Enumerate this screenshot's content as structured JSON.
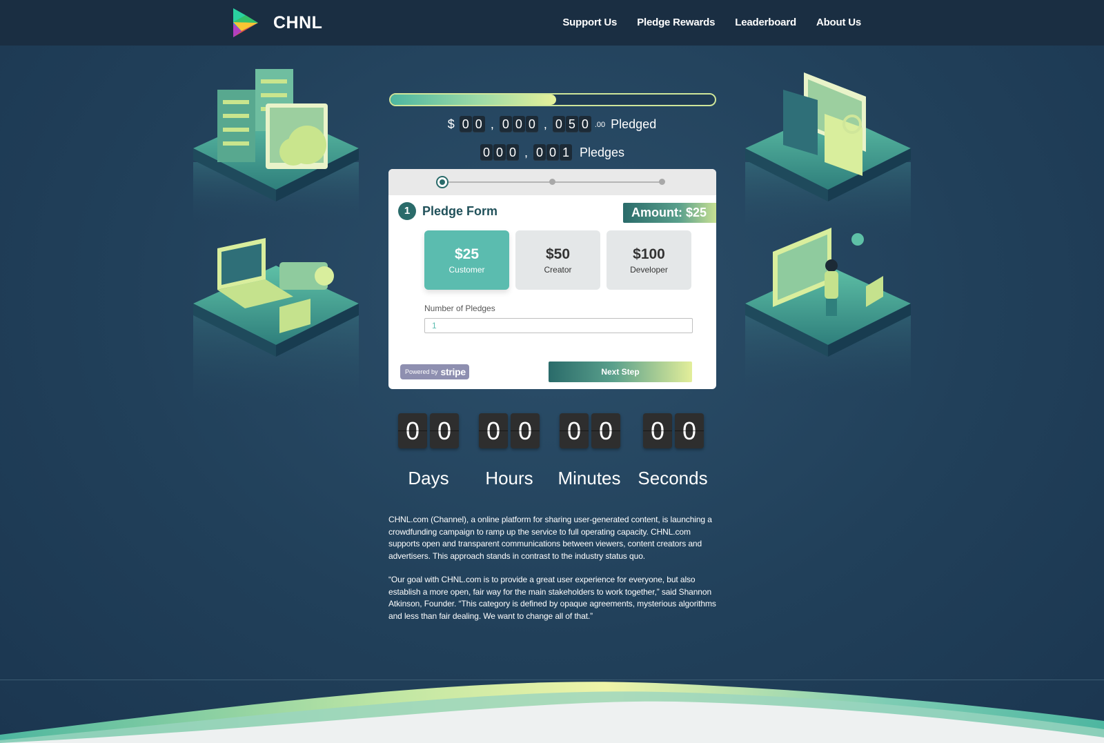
{
  "header": {
    "brand": "CHNL",
    "nav": [
      "Support Us",
      "Pledge Rewards",
      "Leaderboard",
      "About Us"
    ]
  },
  "campaign": {
    "progress_fraction": 0.51,
    "pledged": {
      "currency": "$",
      "groups": [
        "00",
        "000",
        "050"
      ],
      "cents": ".00",
      "label": "Pledged"
    },
    "pledges": {
      "groups": [
        "000",
        "001"
      ],
      "label": "Pledges"
    }
  },
  "form": {
    "step_number": "1",
    "title": "Pledge Form",
    "amount_badge": "Amount: $25",
    "tiers": [
      {
        "price": "$25",
        "role": "Customer",
        "selected": true
      },
      {
        "price": "$50",
        "role": "Creator",
        "selected": false
      },
      {
        "price": "$100",
        "role": "Developer",
        "selected": false
      }
    ],
    "pledges_label": "Number of Pledges",
    "pledges_value": "1",
    "stripe_powered": "Powered by",
    "stripe_word": "stripe",
    "next_button": "Next Step"
  },
  "countdown": {
    "days": [
      "0",
      "0"
    ],
    "hours": [
      "0",
      "0"
    ],
    "minutes": [
      "0",
      "0"
    ],
    "seconds": [
      "0",
      "0"
    ],
    "labels": {
      "days": "Days",
      "hours": "Hours",
      "minutes": "Minutes",
      "seconds": "Seconds"
    }
  },
  "description": {
    "p1": "CHNL.com (Channel), a online platform for sharing user-generated content, is launching a crowdfunding campaign to ramp up the service to full operating capacity. CHNL.com supports open and transparent communications between viewers, content creators and advertisers. This approach stands in contrast to the industry status quo.",
    "p2": "“Our goal with CHNL.com is to provide a great user experience for everyone, but also establish a more open, fair way for the main stakeholders to work together,” said Shannon Atkinson, Founder. “This category is defined by opaque agreements, mysterious algorithms and less than fair dealing. We want to change all of that.”"
  },
  "colors": {
    "background": "#21405a",
    "header": "#1a2e42",
    "accent_teal": "#2a6b6a",
    "accent_mint": "#5bbcaf",
    "accent_lime": "#e3ee9a"
  }
}
